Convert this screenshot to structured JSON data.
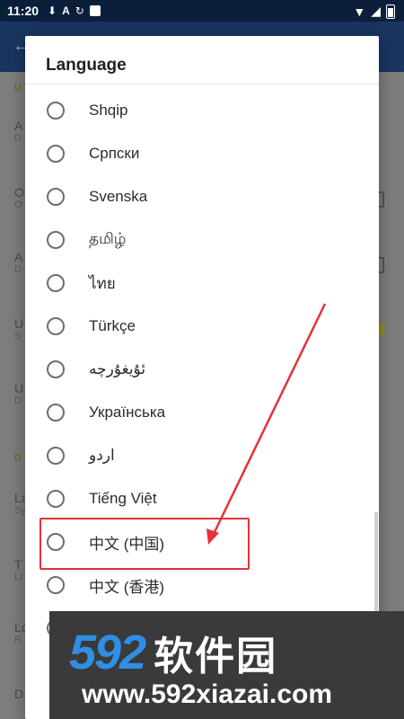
{
  "status_bar": {
    "time": "11:20",
    "icons": [
      "download-icon",
      "a-icon",
      "sync-icon",
      "app-icon"
    ],
    "right_icons": [
      "wifi-icon",
      "signal-icon",
      "battery-icon"
    ]
  },
  "background": {
    "section_1": "U",
    "section_2": "D",
    "rows": [
      {
        "title": "A",
        "subtitle": "D"
      },
      {
        "title": "O",
        "subtitle": "O"
      },
      {
        "title": "A",
        "subtitle": "D"
      },
      {
        "title": "U",
        "subtitle": "S"
      },
      {
        "title": "U",
        "subtitle": "D"
      },
      {
        "title": "La",
        "subtitle": "Sy"
      },
      {
        "title": "T",
        "subtitle": "Li"
      },
      {
        "title": "Lo",
        "subtitle": "R"
      },
      {
        "title": "D",
        "subtitle": ""
      }
    ]
  },
  "dialog": {
    "title": "Language",
    "options": [
      {
        "label": "Shqip",
        "selected": false
      },
      {
        "label": "Српски",
        "selected": false
      },
      {
        "label": "Svenska",
        "selected": false
      },
      {
        "label": "தமிழ்",
        "selected": false
      },
      {
        "label": "ไทย",
        "selected": false
      },
      {
        "label": "Türkçe",
        "selected": false
      },
      {
        "label": "ئۇيغۇرچە",
        "selected": false
      },
      {
        "label": "Українська",
        "selected": false
      },
      {
        "label": "اردو",
        "selected": false
      },
      {
        "label": "Tiếng Việt",
        "selected": false
      },
      {
        "label": "中文 (中国)",
        "selected": false
      },
      {
        "label": "中文 (香港)",
        "selected": false
      },
      {
        "label": "",
        "selected": false
      }
    ]
  },
  "annotation": {
    "color": "#e53238"
  },
  "watermark": {
    "numbers": "592",
    "chinese": "软件园",
    "url": "www.592xiazai.com"
  }
}
